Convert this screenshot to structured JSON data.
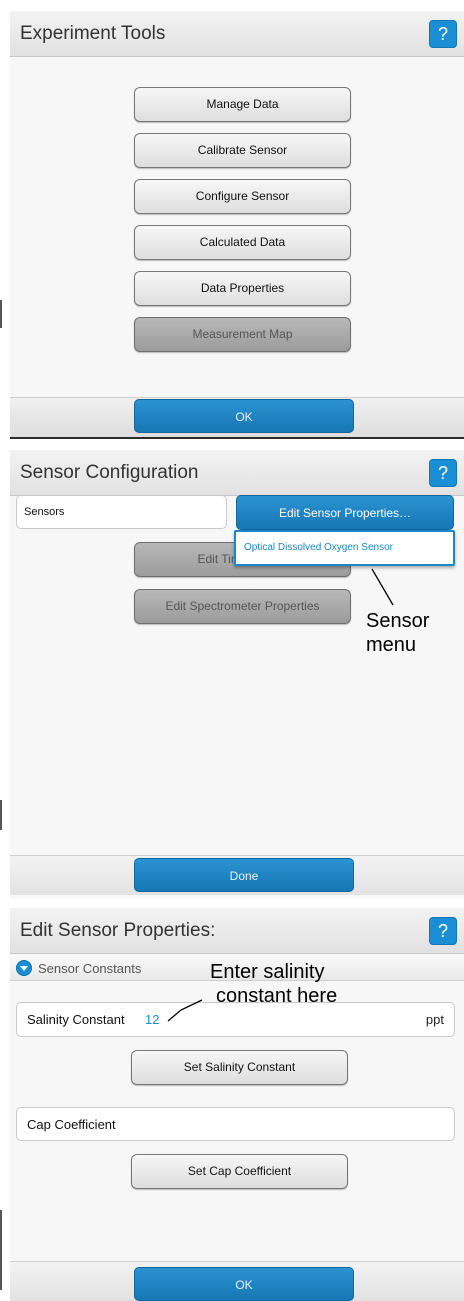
{
  "experiment_tools": {
    "title": "Experiment Tools",
    "help_label": "?",
    "buttons": [
      {
        "label": "Manage Data",
        "enabled": true
      },
      {
        "label": "Calibrate Sensor",
        "enabled": true
      },
      {
        "label": "Configure Sensor",
        "enabled": true
      },
      {
        "label": "Calculated Data",
        "enabled": true
      },
      {
        "label": "Data Properties",
        "enabled": true
      },
      {
        "label": "Measurement Map",
        "enabled": false
      }
    ],
    "ok_label": "OK"
  },
  "sensor_configuration": {
    "title": "Sensor Configuration",
    "help_label": "?",
    "sensors_label": "Sensors",
    "edit_sensor_properties_label": "Edit Sensor Properties…",
    "menu_items": [
      "Optical Dissolved Oxygen Sensor"
    ],
    "edit_time_label": "Edit Time",
    "edit_spectrometer_label": "Edit Spectrometer Properties",
    "done_label": "Done"
  },
  "edit_sensor_properties": {
    "title": "Edit Sensor Properties:",
    "help_label": "?",
    "section_label": "Sensor Constants",
    "salinity": {
      "label": "Salinity Constant",
      "value": "12",
      "unit": "ppt"
    },
    "set_salinity_label": "Set Salinity Constant",
    "cap_coefficient_label": "Cap Coefficient",
    "set_cap_label": "Set Cap Coefficient",
    "ok_label": "OK"
  },
  "annotations": {
    "sensor_menu": [
      "Sensor",
      "menu"
    ],
    "salinity": [
      "Enter salinity",
      "constant here"
    ]
  },
  "colors": {
    "accent_blue": "#1a8fd6",
    "button_gray": "#dedede",
    "disabled_gray": "#a9a9a9"
  }
}
